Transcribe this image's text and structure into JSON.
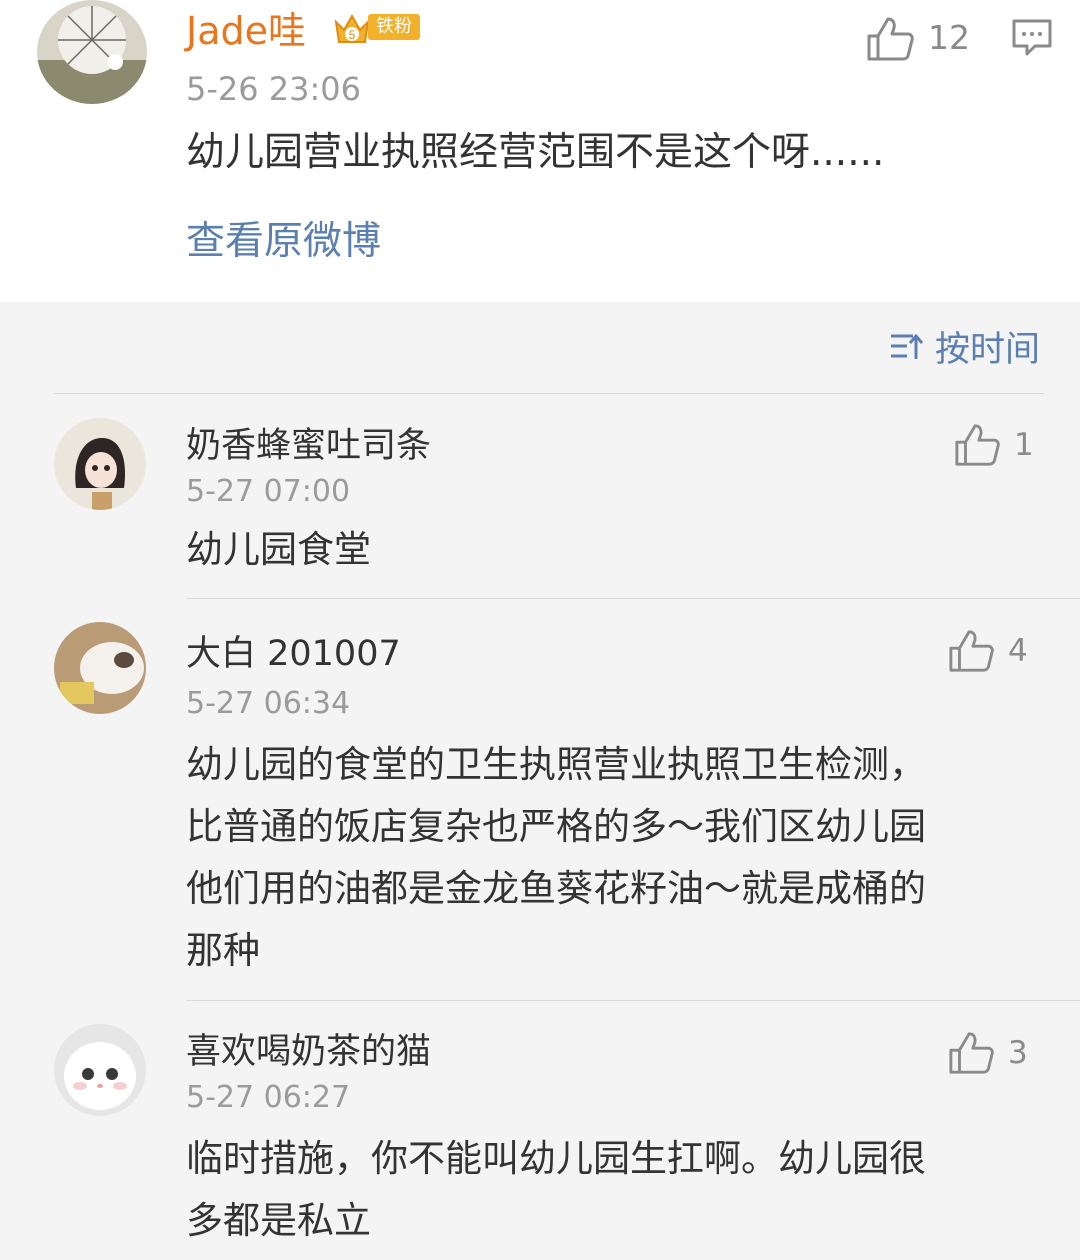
{
  "post": {
    "username": "Jade哇",
    "badge_level": "5",
    "badge_label": "铁粉",
    "time": "5-26 23:06",
    "text": "幼儿园营业执照经营范围不是这个呀......",
    "view_original": "查看原微博",
    "like_count": "12",
    "icons": {
      "like": "thumbs-up-icon",
      "comment": "comment-icon",
      "badge": "crown-icon"
    },
    "accent_color": "#e8761c",
    "link_color": "#5b7faf"
  },
  "sort": {
    "label": "按时间",
    "icon": "sort-icon"
  },
  "replies": [
    {
      "name": "奶香蜂蜜吐司条",
      "time": "5-27 07:00",
      "text": "幼儿园食堂",
      "likes": "1"
    },
    {
      "name": "大白 201007",
      "time": "5-27 06:34",
      "text": "幼儿园的食堂的卫生执照营业执照卫生检测，\n比普通的饭店复杂也严格的多～我们区幼儿园\n他们用的油都是金龙鱼葵花籽油～就是成桶的\n那种",
      "likes": "4"
    },
    {
      "name": "喜欢喝奶茶的猫",
      "time": "5-27 06:27",
      "text": "临时措施，你不能叫幼儿园生扛啊。幼儿园很\n多都是私立",
      "likes": "3"
    }
  ]
}
